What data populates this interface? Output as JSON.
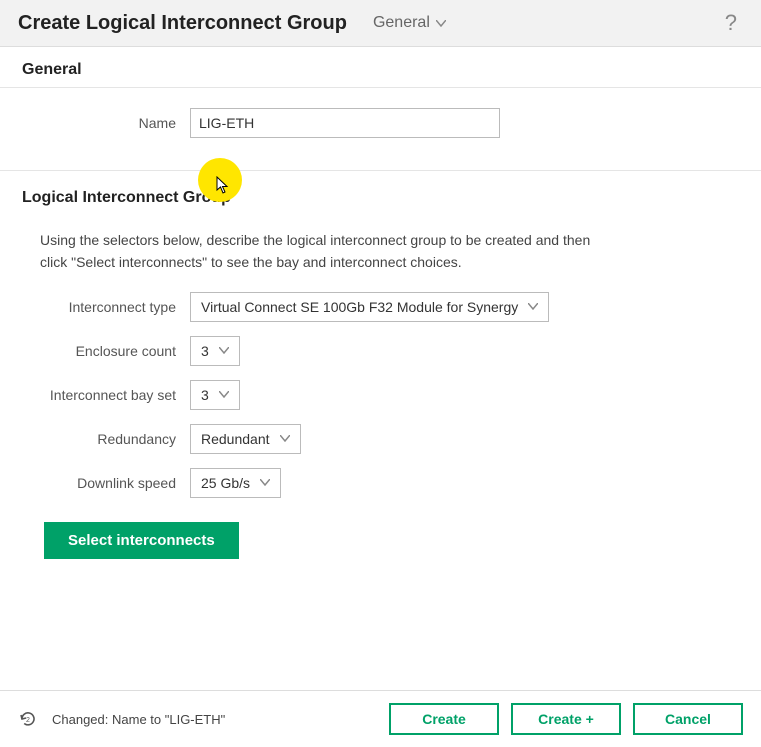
{
  "header": {
    "title": "Create Logical Interconnect Group",
    "nav_dropdown": "General",
    "help": "?"
  },
  "general": {
    "heading": "General",
    "name_label": "Name",
    "name_value": "LIG-ETH"
  },
  "lig": {
    "heading": "Logical Interconnect Group",
    "description": "Using the selectors below, describe the logical interconnect group to be created and then click \"Select interconnects\" to see the bay and interconnect choices.",
    "interconnect_type_label": "Interconnect type",
    "interconnect_type_value": "Virtual Connect SE 100Gb F32 Module for Synergy",
    "enclosure_count_label": "Enclosure count",
    "enclosure_count_value": "3",
    "interconnect_bay_set_label": "Interconnect bay set",
    "interconnect_bay_set_value": "3",
    "redundancy_label": "Redundancy",
    "redundancy_value": "Redundant",
    "downlink_speed_label": "Downlink speed",
    "downlink_speed_value": "25 Gb/s",
    "select_interconnects_button": "Select interconnects"
  },
  "footer": {
    "status": "Changed: Name to \"LIG-ETH\"",
    "create": "Create",
    "create_plus": "Create +",
    "cancel": "Cancel"
  }
}
